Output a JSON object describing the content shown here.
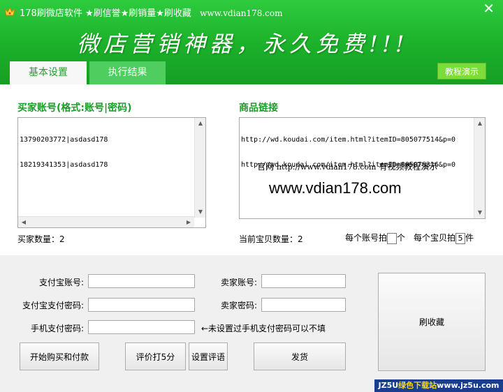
{
  "window": {
    "title": "178刷微店软件 ★刷信誉★刷销量★刷收藏",
    "title_url": "www.vdian178.com",
    "close_glyph": "✕",
    "slogan": "微店营销神器，永久免费!!!"
  },
  "tabs": [
    {
      "label": "基本设置",
      "active": true
    },
    {
      "label": "执行结果",
      "active": false
    }
  ],
  "tutorial_button": "教程演示",
  "buyers": {
    "title": "买家账号(格式:账号|密码)",
    "lines": [
      "13790203772|asdasd178",
      "18219341353|asdasd178"
    ],
    "count_label": "买家数量：",
    "count": "2"
  },
  "products": {
    "title": "商品链接",
    "lines": [
      "http://wd.koudai.com/item.html?itemID=805077514&p=0",
      "http://wd.koudai.com/item.html?itemID=805076316&p=0"
    ],
    "site_label": "官网",
    "site_url": "http://www.vdian178.com",
    "site_note": "有视频教程演示",
    "big_url": "www.vdian178.com",
    "count_label": "当前宝贝数量：",
    "count": "2",
    "per_account_prefix": "每个账号拍",
    "per_account_value": "",
    "per_account_suffix": "个",
    "per_item_prefix": "每个宝贝拍",
    "per_item_value": "5",
    "per_item_suffix": "件"
  },
  "form": {
    "alipay_account_label": "支付宝账号:",
    "alipay_password_label": "支付宝支付密码:",
    "mobile_password_label": "手机支付密码:",
    "mobile_hint": "←未设置过手机支付密码可以不填",
    "seller_account_label": "卖家账号:",
    "seller_password_label": "卖家密码:",
    "alipay_account_value": "",
    "alipay_password_value": "",
    "mobile_password_value": "",
    "seller_account_value": "",
    "seller_password_value": ""
  },
  "buttons": {
    "start": "开始购买和付款",
    "rate": "评价打5分",
    "set_comment": "设置评语",
    "ship": "发货",
    "favorite": "刷收藏"
  },
  "watermark": {
    "prefix": "JZ5U",
    "middle": "绿色下载站",
    "suffix": "www.jz5u.com"
  },
  "colors": {
    "header_green": "#1bb02a",
    "section_title_green": "#1d9b2b",
    "tab_inactive": "#4fcd5e",
    "tutorial_button": "#7edc3a"
  }
}
